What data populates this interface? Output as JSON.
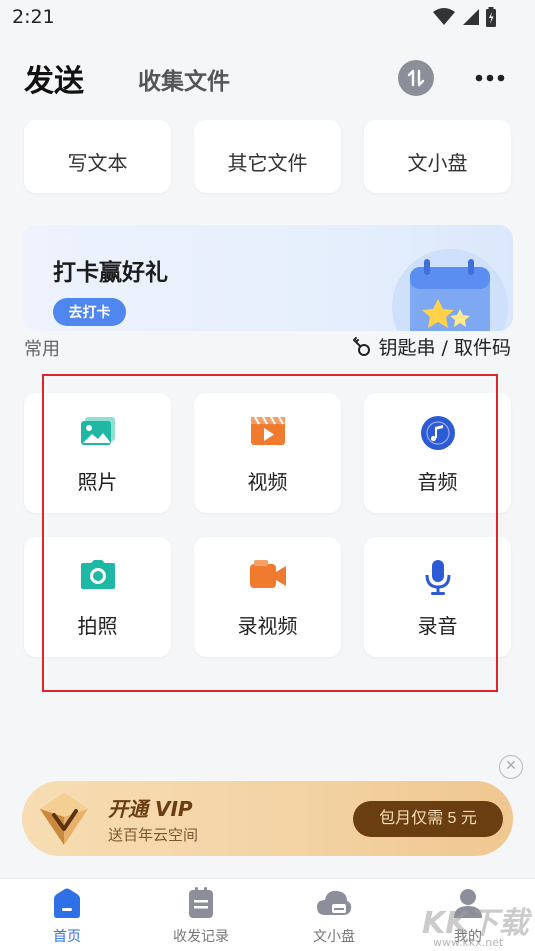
{
  "status_bar": {
    "time": "2:21",
    "icons": [
      "wifi-icon",
      "signal-icon",
      "battery-icon"
    ]
  },
  "header": {
    "tab_active": "发送",
    "tab_other": "收集文件",
    "icons": [
      "transfer-icon",
      "more-icon"
    ]
  },
  "top_cards": [
    {
      "label": "写文本"
    },
    {
      "label": "其它文件"
    },
    {
      "label": "文小盘"
    }
  ],
  "banner": {
    "title": "打卡赢好礼",
    "button": "去打卡"
  },
  "section": {
    "label": "常用",
    "key_link": "钥匙串 / 取件码"
  },
  "grid": [
    {
      "label": "照片",
      "icon": "photo-icon",
      "color": "#1fb8a4"
    },
    {
      "label": "视频",
      "icon": "video-icon",
      "color": "#f07a2e"
    },
    {
      "label": "音频",
      "icon": "audio-icon",
      "color": "#2d5bd6"
    },
    {
      "label": "拍照",
      "icon": "camera-icon",
      "color": "#1fb8a4"
    },
    {
      "label": "录视频",
      "icon": "record-video-icon",
      "color": "#f07a2e"
    },
    {
      "label": "录音",
      "icon": "microphone-icon",
      "color": "#2d5bd6"
    }
  ],
  "vip": {
    "title": "开通 VIP",
    "subtitle": "送百年云空间",
    "button": "包月仅需 5 元"
  },
  "bottom_nav": [
    {
      "label": "首页",
      "icon": "home-icon",
      "active": true
    },
    {
      "label": "收发记录",
      "icon": "records-icon",
      "active": false
    },
    {
      "label": "文小盘",
      "icon": "cloud-disk-icon",
      "active": false
    },
    {
      "label": "我的",
      "icon": "profile-icon",
      "active": false
    }
  ],
  "watermark": {
    "text": "KK下载",
    "url": "www.kkx.net"
  },
  "colors": {
    "accent": "#4f86f0",
    "highlight": "#e0242d",
    "vip_button": "#6a3e10"
  }
}
